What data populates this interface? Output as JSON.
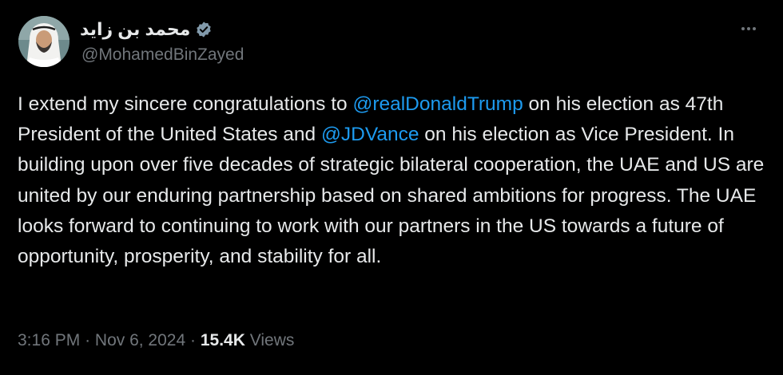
{
  "author": {
    "display_name": "محمد بن زايد",
    "handle": "@MohamedBinZayed"
  },
  "tweet": {
    "parts": [
      {
        "text": "I extend my sincere congratulations to ",
        "type": "text"
      },
      {
        "text": "@realDonaldTrump",
        "type": "mention"
      },
      {
        "text": " on his election as 47th President of the United States and ",
        "type": "text"
      },
      {
        "text": "@JDVance",
        "type": "mention"
      },
      {
        "text": " on his election as Vice President. In building upon over five decades of strategic bilateral cooperation, the UAE and US are united by our enduring partnership based on shared ambitions for progress. The UAE looks forward to continuing to work with our partners in the US towards a future of opportunity, prosperity, and stability for all.",
        "type": "text"
      }
    ]
  },
  "meta": {
    "time": "3:16 PM",
    "separator": "·",
    "date": "Nov 6, 2024",
    "views_count": "15.4K",
    "views_label": "Views"
  },
  "icons": {
    "verified": "verified-badge-icon",
    "more": "more-options-icon"
  },
  "colors": {
    "background": "#000000",
    "text": "#e7e9ea",
    "secondary": "#71767b",
    "mention": "#1d9bf0",
    "verified_badge": "#829aab"
  }
}
